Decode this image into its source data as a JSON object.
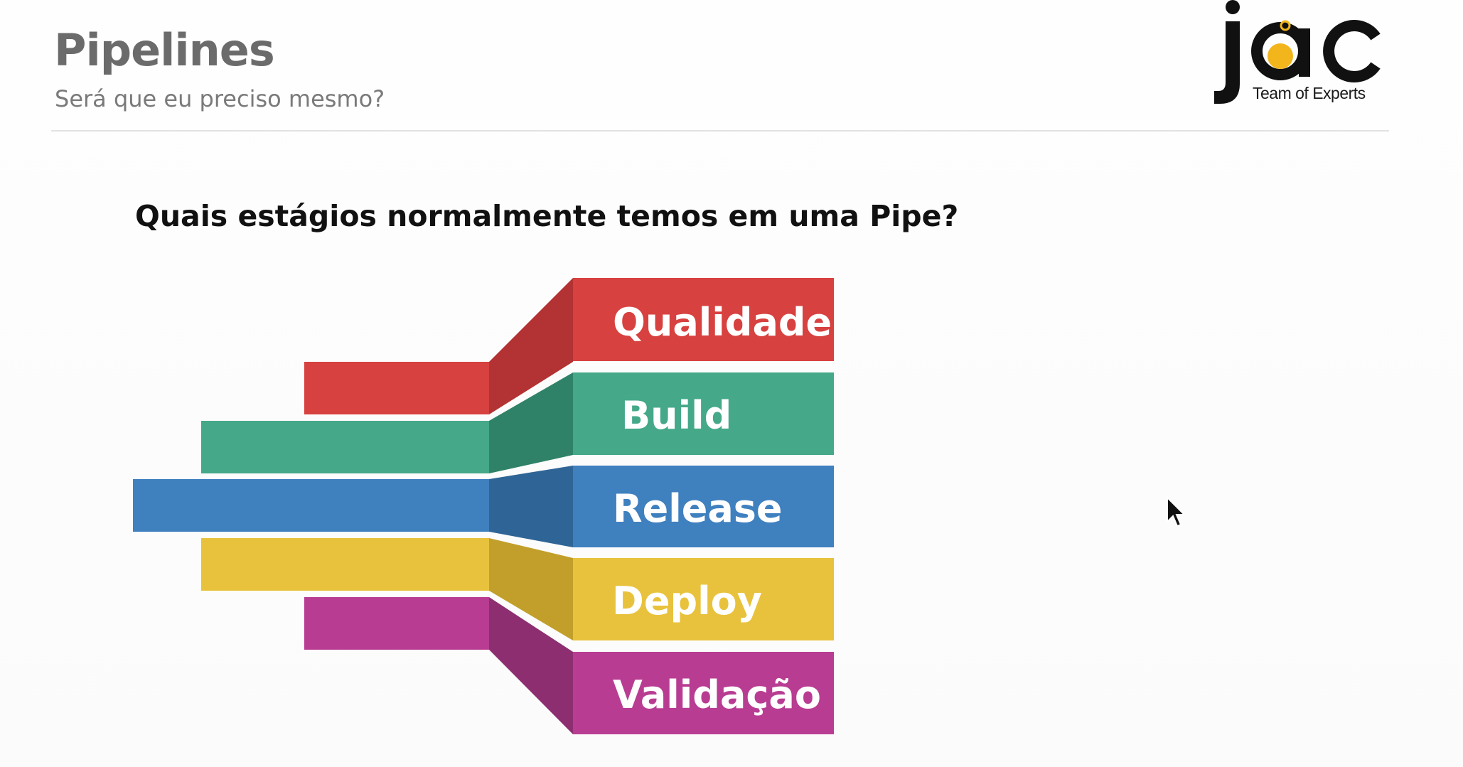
{
  "slide": {
    "title": "Pipelines",
    "subtitle": "Será que eu preciso mesmo?",
    "question": "Quais estágios normalmente temos em uma Pipe?"
  },
  "logo": {
    "wordmark": "jac",
    "tagline": "Team of Experts",
    "colors": {
      "text": "#111111",
      "accent": "#f2b51b"
    }
  },
  "stages": [
    {
      "label": "Qualidade",
      "color": "#d7413f",
      "shade": "#b33234"
    },
    {
      "label": "Build",
      "color": "#44a889",
      "shade": "#2f8268"
    },
    {
      "label": "Release",
      "color": "#3f80bf",
      "shade": "#2f6596"
    },
    {
      "label": "Deploy",
      "color": "#e8c23c",
      "shade": "#c29f2a"
    },
    {
      "label": "Validação",
      "color": "#b83d92",
      "shade": "#8d2e70"
    }
  ],
  "cursor": {
    "icon": "mouse-pointer-icon"
  }
}
